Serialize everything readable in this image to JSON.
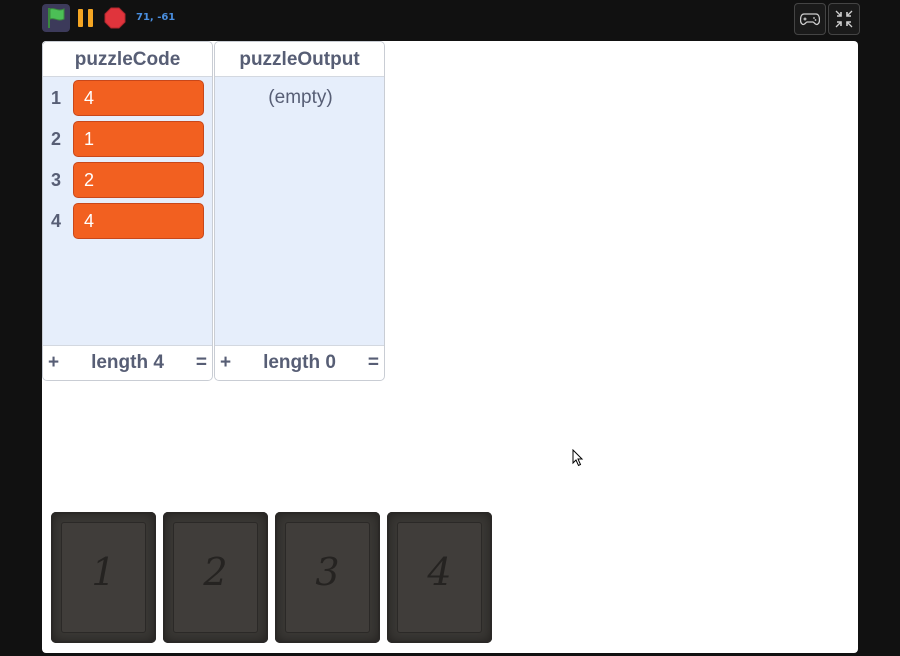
{
  "toolbar": {
    "green_flag_icon": "green-flag-icon",
    "pause_icon": "pause-icon",
    "stop_icon": "stop-icon",
    "coordinates": "71, -61",
    "gamepad_icon": "gamepad-icon",
    "fullscreen_exit_icon": "exit-fullscreen-icon"
  },
  "colors": {
    "list_item": "#f26020",
    "monitor_bg": "#e6eefb",
    "text": "#575e75",
    "coords": "#4a8fe0",
    "stop": "#e0343c",
    "pause": "#f5a623",
    "flag": "#4cbf56"
  },
  "monitors": [
    {
      "title": "puzzleCode",
      "items": [
        {
          "index": "1",
          "value": "4"
        },
        {
          "index": "2",
          "value": "1"
        },
        {
          "index": "3",
          "value": "2"
        },
        {
          "index": "4",
          "value": "4"
        }
      ],
      "footer": {
        "plus": "+",
        "length": "length 4",
        "equals": "="
      }
    },
    {
      "title": "puzzleOutput",
      "empty_text": "(empty)",
      "footer": {
        "plus": "+",
        "length": "length 0",
        "equals": "="
      }
    }
  ],
  "cards": [
    {
      "label": "1"
    },
    {
      "label": "2"
    },
    {
      "label": "3"
    },
    {
      "label": "4"
    }
  ]
}
